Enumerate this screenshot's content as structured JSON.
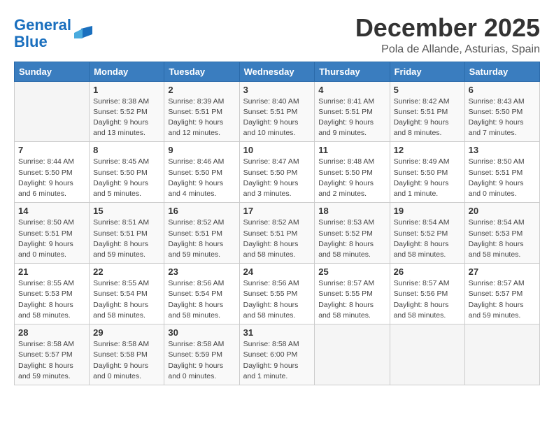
{
  "header": {
    "logo_line1": "General",
    "logo_line2": "Blue",
    "month": "December 2025",
    "location": "Pola de Allande, Asturias, Spain"
  },
  "weekdays": [
    "Sunday",
    "Monday",
    "Tuesday",
    "Wednesday",
    "Thursday",
    "Friday",
    "Saturday"
  ],
  "weeks": [
    [
      {
        "day": "",
        "info": ""
      },
      {
        "day": "1",
        "info": "Sunrise: 8:38 AM\nSunset: 5:52 PM\nDaylight: 9 hours\nand 13 minutes."
      },
      {
        "day": "2",
        "info": "Sunrise: 8:39 AM\nSunset: 5:51 PM\nDaylight: 9 hours\nand 12 minutes."
      },
      {
        "day": "3",
        "info": "Sunrise: 8:40 AM\nSunset: 5:51 PM\nDaylight: 9 hours\nand 10 minutes."
      },
      {
        "day": "4",
        "info": "Sunrise: 8:41 AM\nSunset: 5:51 PM\nDaylight: 9 hours\nand 9 minutes."
      },
      {
        "day": "5",
        "info": "Sunrise: 8:42 AM\nSunset: 5:51 PM\nDaylight: 9 hours\nand 8 minutes."
      },
      {
        "day": "6",
        "info": "Sunrise: 8:43 AM\nSunset: 5:50 PM\nDaylight: 9 hours\nand 7 minutes."
      }
    ],
    [
      {
        "day": "7",
        "info": "Sunrise: 8:44 AM\nSunset: 5:50 PM\nDaylight: 9 hours\nand 6 minutes."
      },
      {
        "day": "8",
        "info": "Sunrise: 8:45 AM\nSunset: 5:50 PM\nDaylight: 9 hours\nand 5 minutes."
      },
      {
        "day": "9",
        "info": "Sunrise: 8:46 AM\nSunset: 5:50 PM\nDaylight: 9 hours\nand 4 minutes."
      },
      {
        "day": "10",
        "info": "Sunrise: 8:47 AM\nSunset: 5:50 PM\nDaylight: 9 hours\nand 3 minutes."
      },
      {
        "day": "11",
        "info": "Sunrise: 8:48 AM\nSunset: 5:50 PM\nDaylight: 9 hours\nand 2 minutes."
      },
      {
        "day": "12",
        "info": "Sunrise: 8:49 AM\nSunset: 5:50 PM\nDaylight: 9 hours\nand 1 minute."
      },
      {
        "day": "13",
        "info": "Sunrise: 8:50 AM\nSunset: 5:51 PM\nDaylight: 9 hours\nand 0 minutes."
      }
    ],
    [
      {
        "day": "14",
        "info": "Sunrise: 8:50 AM\nSunset: 5:51 PM\nDaylight: 9 hours\nand 0 minutes."
      },
      {
        "day": "15",
        "info": "Sunrise: 8:51 AM\nSunset: 5:51 PM\nDaylight: 8 hours\nand 59 minutes."
      },
      {
        "day": "16",
        "info": "Sunrise: 8:52 AM\nSunset: 5:51 PM\nDaylight: 8 hours\nand 59 minutes."
      },
      {
        "day": "17",
        "info": "Sunrise: 8:52 AM\nSunset: 5:51 PM\nDaylight: 8 hours\nand 58 minutes."
      },
      {
        "day": "18",
        "info": "Sunrise: 8:53 AM\nSunset: 5:52 PM\nDaylight: 8 hours\nand 58 minutes."
      },
      {
        "day": "19",
        "info": "Sunrise: 8:54 AM\nSunset: 5:52 PM\nDaylight: 8 hours\nand 58 minutes."
      },
      {
        "day": "20",
        "info": "Sunrise: 8:54 AM\nSunset: 5:53 PM\nDaylight: 8 hours\nand 58 minutes."
      }
    ],
    [
      {
        "day": "21",
        "info": "Sunrise: 8:55 AM\nSunset: 5:53 PM\nDaylight: 8 hours\nand 58 minutes."
      },
      {
        "day": "22",
        "info": "Sunrise: 8:55 AM\nSunset: 5:54 PM\nDaylight: 8 hours\nand 58 minutes."
      },
      {
        "day": "23",
        "info": "Sunrise: 8:56 AM\nSunset: 5:54 PM\nDaylight: 8 hours\nand 58 minutes."
      },
      {
        "day": "24",
        "info": "Sunrise: 8:56 AM\nSunset: 5:55 PM\nDaylight: 8 hours\nand 58 minutes."
      },
      {
        "day": "25",
        "info": "Sunrise: 8:57 AM\nSunset: 5:55 PM\nDaylight: 8 hours\nand 58 minutes."
      },
      {
        "day": "26",
        "info": "Sunrise: 8:57 AM\nSunset: 5:56 PM\nDaylight: 8 hours\nand 58 minutes."
      },
      {
        "day": "27",
        "info": "Sunrise: 8:57 AM\nSunset: 5:57 PM\nDaylight: 8 hours\nand 59 minutes."
      }
    ],
    [
      {
        "day": "28",
        "info": "Sunrise: 8:58 AM\nSunset: 5:57 PM\nDaylight: 8 hours\nand 59 minutes."
      },
      {
        "day": "29",
        "info": "Sunrise: 8:58 AM\nSunset: 5:58 PM\nDaylight: 9 hours\nand 0 minutes."
      },
      {
        "day": "30",
        "info": "Sunrise: 8:58 AM\nSunset: 5:59 PM\nDaylight: 9 hours\nand 0 minutes."
      },
      {
        "day": "31",
        "info": "Sunrise: 8:58 AM\nSunset: 6:00 PM\nDaylight: 9 hours\nand 1 minute."
      },
      {
        "day": "",
        "info": ""
      },
      {
        "day": "",
        "info": ""
      },
      {
        "day": "",
        "info": ""
      }
    ]
  ]
}
